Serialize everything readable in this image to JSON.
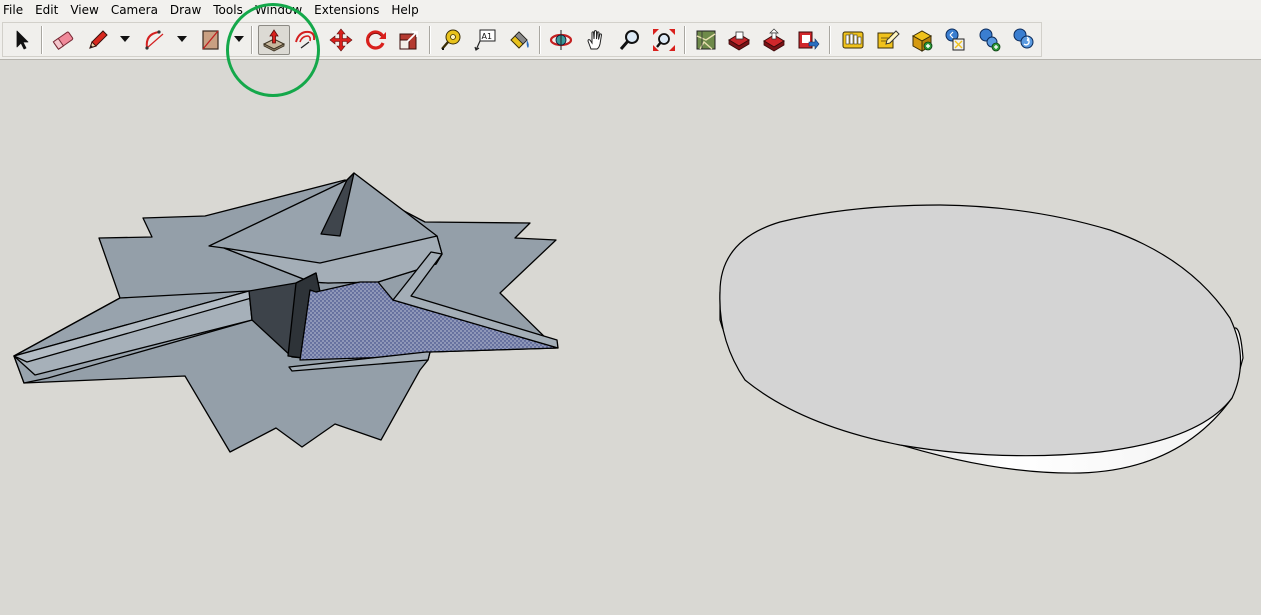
{
  "menu": {
    "items": [
      "File",
      "Edit",
      "View",
      "Camera",
      "Draw",
      "Tools",
      "Window",
      "Extensions",
      "Help"
    ]
  },
  "toolbar": {
    "tools": [
      {
        "icon": "select-arrow-icon",
        "tooltip": "Select"
      },
      {
        "icon": "eraser-icon",
        "tooltip": "Eraser"
      },
      {
        "icon": "pencil-line-icon",
        "tooltip": "Line"
      },
      {
        "icon": "arc-icon",
        "tooltip": "Arc"
      },
      {
        "icon": "rectangle-icon",
        "tooltip": "Rectangle"
      },
      {
        "icon": "push-pull-icon",
        "tooltip": "Push/Pull",
        "active": true
      },
      {
        "icon": "offset-icon",
        "tooltip": "Offset"
      },
      {
        "icon": "move-icon",
        "tooltip": "Move"
      },
      {
        "icon": "rotate-icon",
        "tooltip": "Rotate"
      },
      {
        "icon": "scale-icon",
        "tooltip": "Scale"
      },
      {
        "icon": "tape-measure-icon",
        "tooltip": "Tape Measure"
      },
      {
        "icon": "text-icon",
        "tooltip": "Text",
        "glyph": "A1"
      },
      {
        "icon": "paint-bucket-icon",
        "tooltip": "Paint Bucket"
      },
      {
        "icon": "orbit-icon",
        "tooltip": "Orbit"
      },
      {
        "icon": "pan-hand-icon",
        "tooltip": "Pan"
      },
      {
        "icon": "zoom-icon",
        "tooltip": "Zoom"
      },
      {
        "icon": "zoom-extents-icon",
        "tooltip": "Zoom Extents"
      },
      {
        "icon": "add-location-icon",
        "tooltip": "Add Location"
      },
      {
        "icon": "3d-warehouse-icon",
        "tooltip": "3D Warehouse"
      },
      {
        "icon": "get-models-icon",
        "tooltip": "Get Models"
      },
      {
        "icon": "share-model-icon",
        "tooltip": "Share Model"
      },
      {
        "icon": "extension-warehouse-icon",
        "tooltip": "Extension Warehouse"
      },
      {
        "icon": "edit-component-icon",
        "tooltip": "Edit Component"
      },
      {
        "icon": "make-component-icon",
        "tooltip": "Make Component"
      },
      {
        "icon": "dynamic-components-icon",
        "tooltip": "Dynamic Components"
      },
      {
        "icon": "component-options-icon",
        "tooltip": "Component Options"
      },
      {
        "icon": "component-attributes-icon",
        "tooltip": "Component Attributes"
      }
    ]
  },
  "colors": {
    "canvas_bg": "#d9d8d3",
    "face_front": "#9aa6b0",
    "face_selected": "#8f97b8",
    "highlight_ring": "#14a84a",
    "push_pull_arrow": "#d9201c"
  },
  "scene": {
    "objects": [
      {
        "name": "star-shape",
        "state": "partially push-pulled, inner face selected"
      },
      {
        "name": "disc-shape",
        "state": "extruded circle"
      }
    ]
  }
}
